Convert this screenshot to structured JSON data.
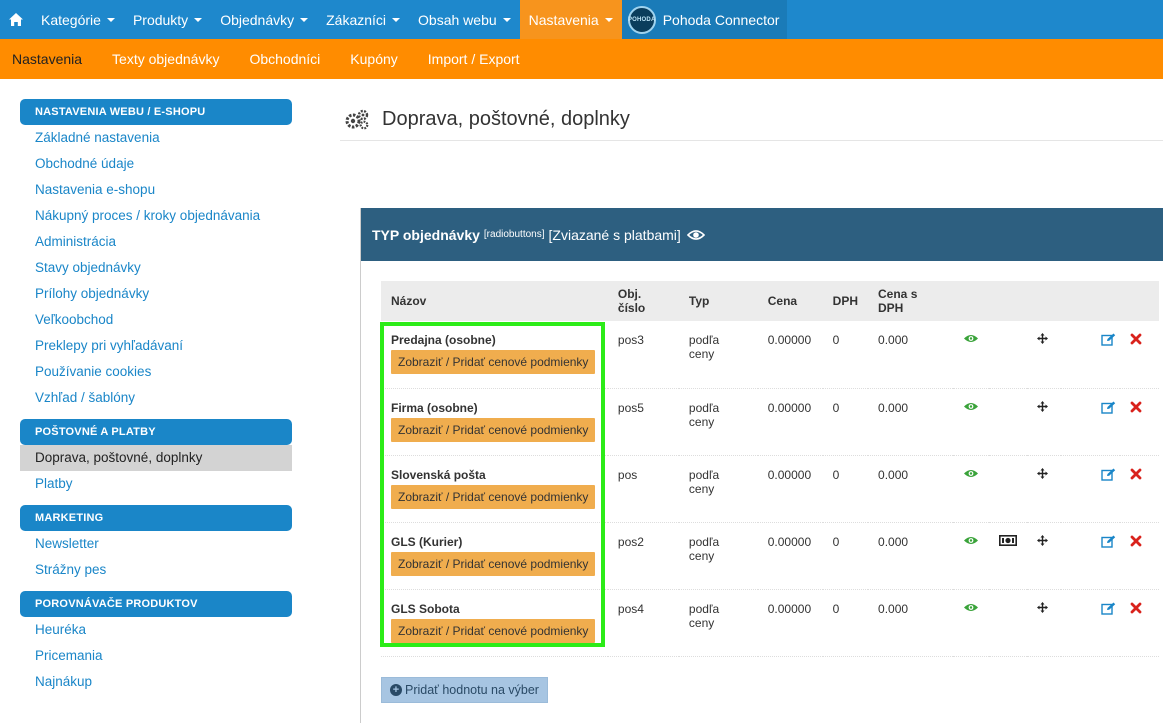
{
  "topnav": {
    "items": [
      {
        "label": "Kategórie"
      },
      {
        "label": "Produkty"
      },
      {
        "label": "Objednávky"
      },
      {
        "label": "Zákazníci"
      },
      {
        "label": "Obsah webu"
      },
      {
        "label": "Nastavenia"
      }
    ],
    "connector_label": "Pohoda Connector",
    "connector_logo_text": "POHODA",
    "active_color": "#f7941d",
    "bar_color": "#1e88cc"
  },
  "subnav": {
    "items": [
      {
        "label": "Nastavenia"
      },
      {
        "label": "Texty objednávky"
      },
      {
        "label": "Obchodníci"
      },
      {
        "label": "Kupóny"
      },
      {
        "label": "Import / Export"
      }
    ]
  },
  "sidebar": {
    "sections": [
      {
        "title": "NASTAVENIA WEBU / E-SHOPU",
        "items": [
          "Základné nastavenia",
          "Obchodné údaje",
          "Nastavenia e-shopu",
          "Nákupný proces / kroky objednávania",
          "Administrácia",
          "Stavy objednávky",
          "Prílohy objednávky",
          "Veľkoobchod",
          "Preklepy pri vyhľadávaní",
          "Používanie cookies",
          "Vzhľad / šablóny"
        ]
      },
      {
        "title": "POŠTOVNÉ A PLATBY",
        "items": [
          "Doprava, poštovné, doplnky",
          "Platby"
        ]
      },
      {
        "title": "MARKETING",
        "items": [
          "Newsletter",
          "Strážny pes"
        ]
      },
      {
        "title": "POROVNÁVAČE PRODUKTOV",
        "items": [
          "Heuréka",
          "Pricemania",
          "Najnákup"
        ]
      }
    ]
  },
  "main": {
    "title": "Doprava, poštovné, doplnky",
    "panel": {
      "title_bold": "TYP objednávky",
      "title_small": "[radiobuttons]",
      "title_rest": "[Zviazané s platbami]"
    },
    "table": {
      "headers": [
        "Názov",
        "Obj. číslo",
        "Typ",
        "Cena",
        "DPH",
        "Cena s DPH"
      ],
      "rows": [
        {
          "name": "Predajna (osobne)",
          "button": "Zobraziť / Pridať cenové podmienky",
          "code": "pos3",
          "type": "podľa ceny",
          "price": "0.00000",
          "vat": "0",
          "price_vat": "0.000"
        },
        {
          "name": "Firma (osobne)",
          "button": "Zobraziť / Pridať cenové podmienky",
          "code": "pos5",
          "type": "podľa ceny",
          "price": "0.00000",
          "vat": "0",
          "price_vat": "0.000"
        },
        {
          "name": "Slovenská pošta",
          "button": "Zobraziť / Pridať cenové podmienky",
          "code": "pos",
          "type": "podľa ceny",
          "price": "0.00000",
          "vat": "0",
          "price_vat": "0.000"
        },
        {
          "name": "GLS (Kurier)",
          "button": "Zobraziť / Pridať cenové podmienky",
          "code": "pos2",
          "type": "podľa ceny",
          "price": "0.00000",
          "vat": "0",
          "price_vat": "0.000"
        },
        {
          "name": "GLS Sobota",
          "button": "Zobraziť / Pridať cenové podmienky",
          "code": "pos4",
          "type": "podľa ceny",
          "price": "0.00000",
          "vat": "0",
          "price_vat": "0.000"
        }
      ]
    },
    "add_button_label": "Pridať hodnotu na výber",
    "icons": {
      "view": "eye-icon",
      "money": "money-icon",
      "move": "move-icon",
      "edit": "edit-icon",
      "delete": "delete-icon"
    },
    "colors": {
      "eye": "#3aa33a",
      "edit": "#1a86c8",
      "delete": "#d9221c",
      "highlight": "#2cec18"
    }
  }
}
